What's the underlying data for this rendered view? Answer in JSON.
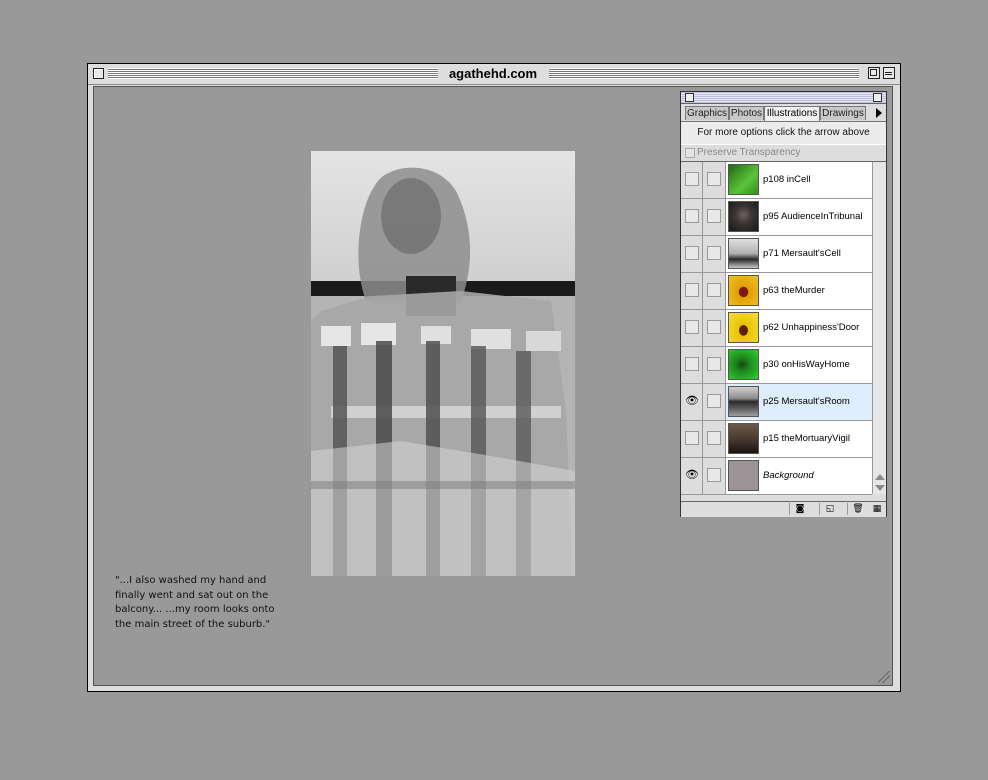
{
  "window": {
    "title": "agathehd.com"
  },
  "artwork": {
    "caption": "\"...I also washed my hand and finally went and sat out on the balcony... ...my room looks onto the main street of the suburb.\""
  },
  "palette": {
    "tabs": [
      {
        "label": "Graphics",
        "active": false
      },
      {
        "label": "Photos",
        "active": false
      },
      {
        "label": "Illustrations",
        "active": true
      },
      {
        "label": "Drawings",
        "active": false
      }
    ],
    "options_text": "For more options click the arrow above",
    "preserve_transparency": "Preserve Transparency",
    "layers": [
      {
        "name": "p108 inCell",
        "visible": false,
        "thumb_color": "#2f8f1f"
      },
      {
        "name": "p95 AudienceInTribunal",
        "visible": false,
        "thumb_color": "#3a3532"
      },
      {
        "name": "p71 Mersault'sCell",
        "visible": false,
        "thumb_color": "#b0b0b0"
      },
      {
        "name": "p63 theMurder",
        "visible": false,
        "thumb_color": "#e0a000"
      },
      {
        "name": "p62 Unhappiness'Door",
        "visible": false,
        "thumb_color": "#e8c400"
      },
      {
        "name": "p30 onHisWayHome",
        "visible": false,
        "thumb_color": "#2fd02f"
      },
      {
        "name": "p25 Mersault'sRoom",
        "visible": true,
        "selected": true,
        "thumb_color": "#6a6a6a"
      },
      {
        "name": "p15 theMortuaryVigil",
        "visible": false,
        "thumb_color": "#4a3a30"
      },
      {
        "name": "Background",
        "visible": true,
        "italic": true,
        "thumb_color": "#9a9496"
      }
    ]
  }
}
